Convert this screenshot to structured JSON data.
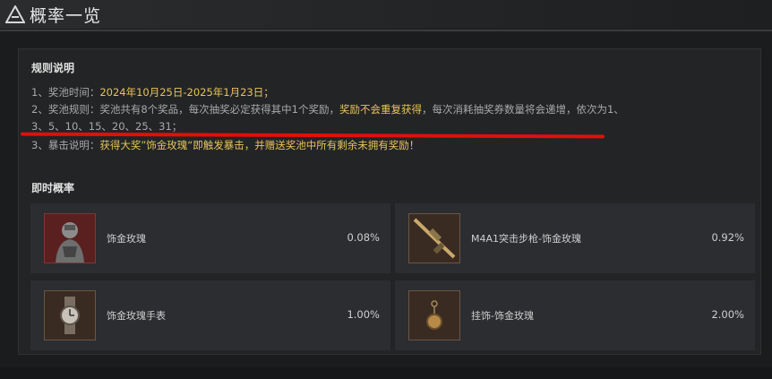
{
  "header": {
    "title": "概率一览"
  },
  "rules": {
    "heading": "规则说明",
    "line1_prefix": "1、奖池时间：",
    "line1_value": "2024年10月25日-2025年1月23日；",
    "line2_prefix": "2、奖池规则：奖池共有8个奖品，每次抽奖必定获得其中1个奖励，",
    "line2_highlight": "奖励不会重复获得",
    "line2_suffix": "，每次消耗抽奖券数量将会递增，依次为1、",
    "line2_cont": "3、5、10、15、20、25、31；",
    "line3_prefix": "3、暴击说明：",
    "line3_highlight": "获得大奖”饰金玫瑰“即触发暴击，并赠送奖池中所有剩余未拥有奖励！"
  },
  "probability": {
    "heading": "即时概率",
    "items": [
      {
        "name": "饰金玫瑰",
        "rate": "0.08%",
        "icon": "gold-rose-operator-icon"
      },
      {
        "name": "M4A1突击步枪-饰金玫瑰",
        "rate": "0.92%",
        "icon": "rifle-icon"
      },
      {
        "name": "饰金玫瑰手表",
        "rate": "1.00%",
        "icon": "watch-icon"
      },
      {
        "name": "挂饰-饰金玫瑰",
        "rate": "2.00%",
        "icon": "charm-icon"
      }
    ]
  },
  "colors": {
    "highlight": "#e8c35a",
    "annotation_line": "#e0100a"
  }
}
